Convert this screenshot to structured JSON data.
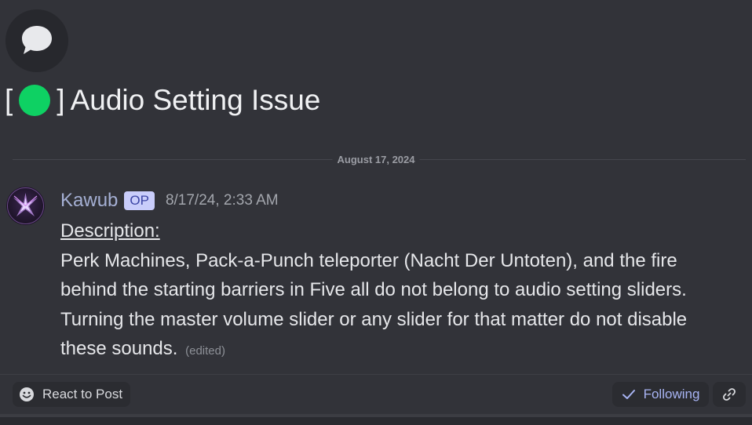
{
  "thread": {
    "open_bracket": "[",
    "close_bracket": "]",
    "status_color": "#0ed163",
    "title": "Audio Setting Issue",
    "icon": "chat-bubble-icon"
  },
  "date_divider": "August 17, 2024",
  "message": {
    "author": "Kawub",
    "badge": "OP",
    "timestamp": "8/17/24, 2:33 AM",
    "heading": "Description:",
    "body": "Perk Machines, Pack-a-Punch teleporter (Nacht Der Untoten), and the fire behind the starting barriers in Five all do not belong to audio setting sliders. Turning the master volume slider or any slider for that matter do not disable these sounds.",
    "edited_label": "(edited)",
    "avatar_icon": "avatar-kawub-logo",
    "avatar_caption": "Kawub"
  },
  "footer": {
    "react_label": "React to Post",
    "react_icon": "smiley-icon",
    "following_label": "Following",
    "following_icon": "checkmark-icon",
    "link_icon": "link-icon"
  },
  "colors": {
    "background": "#323339",
    "username": "#a5b0d4",
    "badge_bg": "#c9cdfb",
    "following_text": "#a8b4f4"
  }
}
